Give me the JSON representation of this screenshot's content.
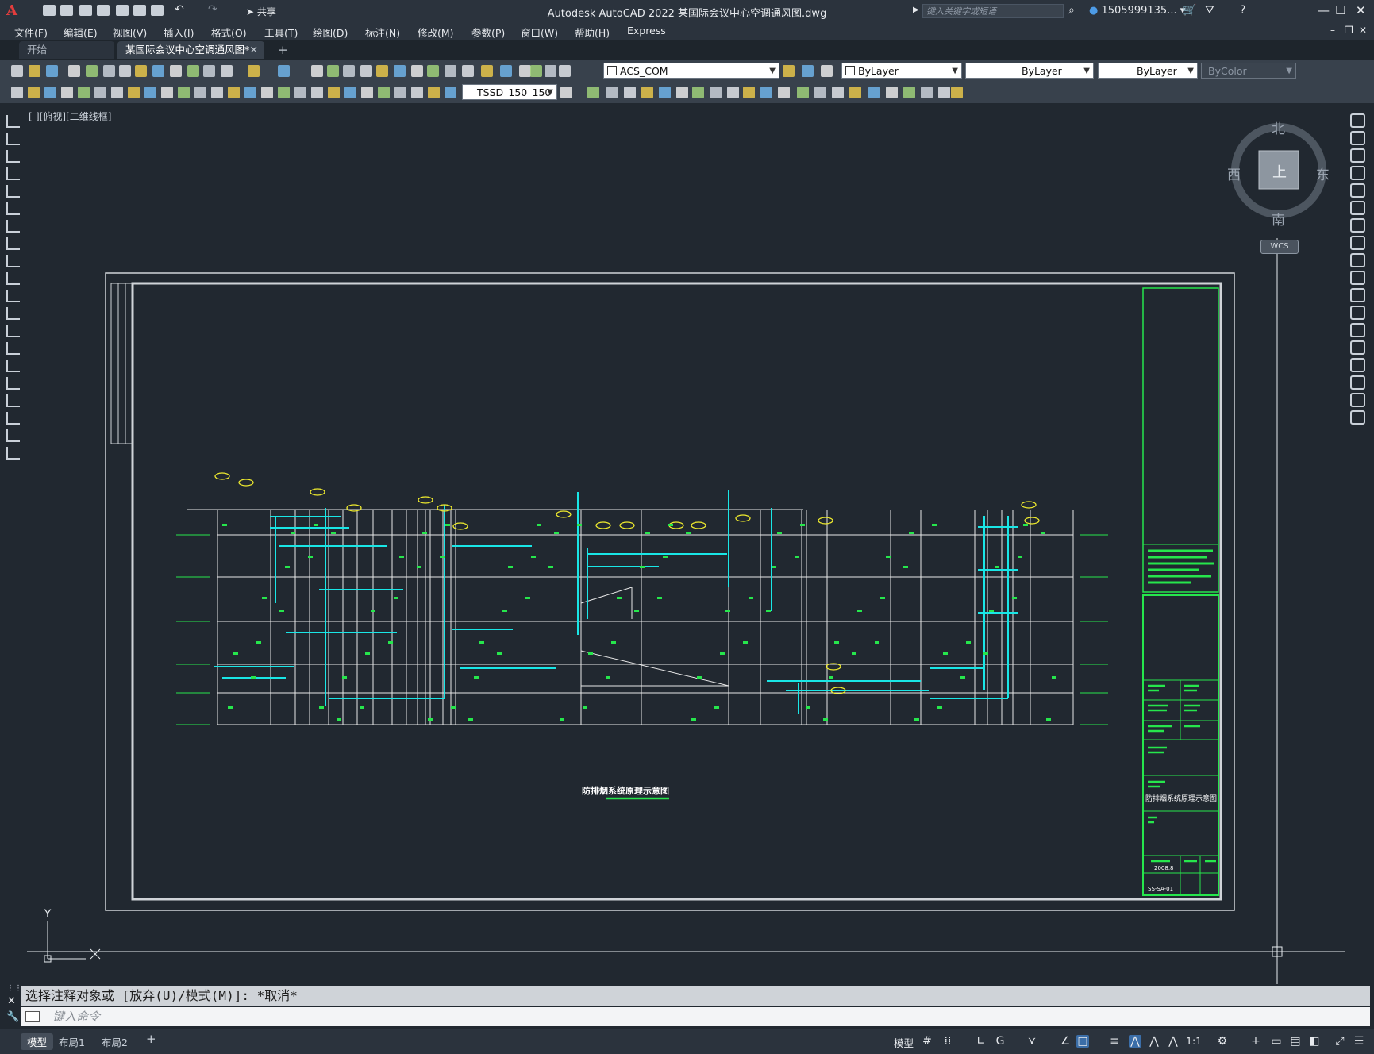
{
  "titlebar": {
    "app_title": "Autodesk AutoCAD 2022    某国际会议中心空调通风图.dwg",
    "share_label": "共享",
    "search_placeholder": "键入关键字或短语",
    "user_name": "1505999135...",
    "logo": "A"
  },
  "menu": [
    "文件(F)",
    "编辑(E)",
    "视图(V)",
    "插入(I)",
    "格式(O)",
    "工具(T)",
    "绘图(D)",
    "标注(N)",
    "修改(M)",
    "参数(P)",
    "窗口(W)",
    "帮助(H)",
    "Express"
  ],
  "tabs": {
    "start": "开始",
    "active": "某国际会议中心空调通风图*",
    "close": "✕",
    "add": "+"
  },
  "toolbar": {
    "layer_combo": "ACS_COM",
    "color_combo": "ByLayer",
    "linetype_combo": "ByLayer",
    "lineweight_combo": "ByLayer",
    "plotstyle_combo": "ByColor",
    "dimstyle_combo": "TSSD_150_150"
  },
  "viewport": {
    "label": "[-][俯视][二维线框]",
    "drawing_title": "防排烟系统原理示意图",
    "titleblock_name": "防排烟系统原理示意图",
    "titleblock_date": "2008.8",
    "titleblock_code": "SS-SA-01",
    "ucs_y_label": "Y"
  },
  "viewcube": {
    "north": "北",
    "south": "南",
    "west": "西",
    "east": "东",
    "face": "上",
    "wcs": "WCS"
  },
  "command": {
    "history": "选择注释对象或 [放弃(U)/模式(M)]: *取消*",
    "placeholder": "键入命令"
  },
  "status": {
    "layouts": [
      "模型",
      "布局1",
      "布局2"
    ],
    "model_label": "模型",
    "scale": "1:1"
  },
  "colors": {
    "background": "#212830",
    "cyan_duct": "#19e6e6",
    "green_label": "#26e64c",
    "yellow_tag": "#f0ec2e",
    "white_line": "#e8e8e8"
  }
}
